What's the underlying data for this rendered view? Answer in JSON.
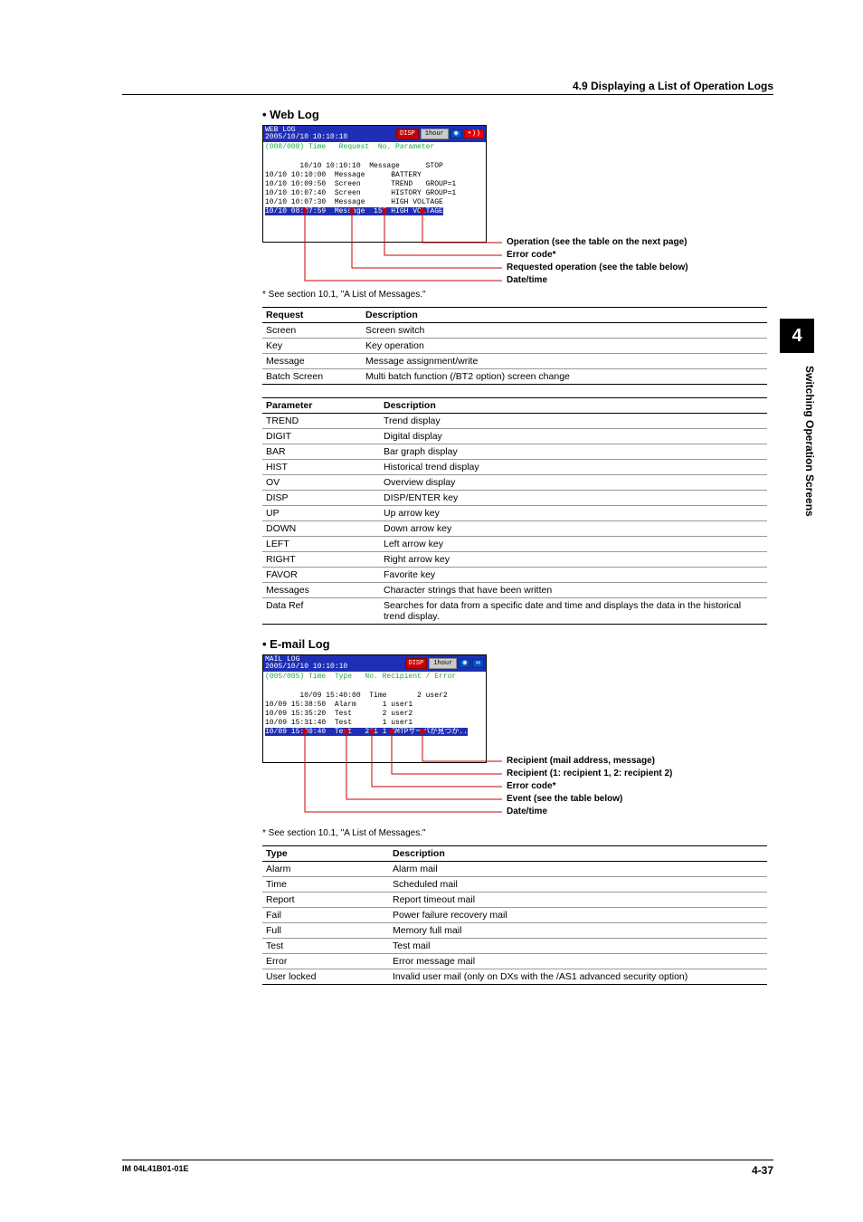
{
  "header": {
    "section_title": "4.9  Displaying a List of Operation Logs"
  },
  "weblog": {
    "heading_bullet": "•  Web Log",
    "title_left": "WEB LOG\n2005/10/10 10:10:10",
    "badge_disp": "DISP",
    "badge_period": "1hour",
    "header_row": "(008/008) Time   Request  No. Parameter",
    "rows": "10/10 10:10:10  Message      STOP\n10/10 10:10:00  Message      BATTERY\n10/10 10:09:50  Screen       TREND   GROUP=1\n10/10 10:07:40  Screen       HISTORY GROUP=1\n10/10 10:07:30  Message      HIGH VOLTAGE",
    "row_hilite": "10/10 08:37:59  Message  155 HIGH VOLTAGE",
    "callouts": {
      "op": "Operation (see the table on the next page)",
      "err": "Error code*",
      "req": "Requested operation (see the table below)",
      "dt": "Date/time"
    },
    "footnote": "*   See section 10.1, \"A List of Messages.\""
  },
  "request_table": {
    "col1": "Request",
    "col2": "Description",
    "rows": [
      [
        "Screen",
        "Screen switch"
      ],
      [
        "Key",
        "Key operation"
      ],
      [
        "Message",
        "Message assignment/write"
      ],
      [
        "Batch Screen",
        "Multi batch function (/BT2 option) screen change"
      ]
    ]
  },
  "parameter_table": {
    "col1": "Parameter",
    "col2": "Description",
    "rows": [
      [
        "TREND",
        "Trend display"
      ],
      [
        "DIGIT",
        "Digital display"
      ],
      [
        "BAR",
        "Bar graph display"
      ],
      [
        "HIST",
        "Historical trend display"
      ],
      [
        "OV",
        "Overview display"
      ],
      [
        "DISP",
        "DISP/ENTER key"
      ],
      [
        "UP",
        "Up arrow key"
      ],
      [
        "DOWN",
        "Down arrow key"
      ],
      [
        "LEFT",
        "Left arrow key"
      ],
      [
        "RIGHT",
        "Right arrow key"
      ],
      [
        "FAVOR",
        "Favorite key"
      ],
      [
        "Messages",
        "Character strings that have been written"
      ],
      [
        "Data Ref",
        "Searches for data from a specific date and time and displays the data in the historical trend display."
      ]
    ]
  },
  "emaillog": {
    "heading_bullet": "•  E-mail Log",
    "title_left": "MAIL LOG\n2005/10/10 10:10:10",
    "badge_disp": "DISP",
    "badge_period": "1hour",
    "envelope_aria": "envelope-icon",
    "header_row": "(005/005) Time  Type   No. Recipient / Error",
    "rows": "10/09 15:40:00  Time       2 user2\n10/09 15:38:50  Alarm      1 user1\n10/09 15:35:20  Test       2 user2\n10/09 15:31:40  Test       1 user1",
    "row_hilite": "10/09 15:30:40  Test   261 1 SMTPサーバが見つか..",
    "callouts": {
      "recip": "Recipient (mail address, message)",
      "recip12": "Recipient (1: recipient 1, 2: recipient 2)",
      "err": "Error code*",
      "event": "Event (see the table below)",
      "dt": "Date/time"
    },
    "footnote": "*   See section 10.1, \"A List of Messages.\""
  },
  "type_table": {
    "col1": "Type",
    "col2": "Description",
    "rows": [
      [
        "Alarm",
        "Alarm mail"
      ],
      [
        "Time",
        "Scheduled mail"
      ],
      [
        "Report",
        "Report timeout mail"
      ],
      [
        "Fail",
        "Power failure recovery mail"
      ],
      [
        "Full",
        "Memory full mail"
      ],
      [
        "Test",
        "Test mail"
      ],
      [
        "Error",
        "Error message mail"
      ],
      [
        "User locked",
        "Invalid user mail (only on DXs with the /AS1 advanced security option)"
      ]
    ]
  },
  "side": {
    "tab": "4",
    "text": "Switching Operation Screens"
  },
  "footer": {
    "left": "IM 04L41B01-01E",
    "right": "4-37"
  }
}
